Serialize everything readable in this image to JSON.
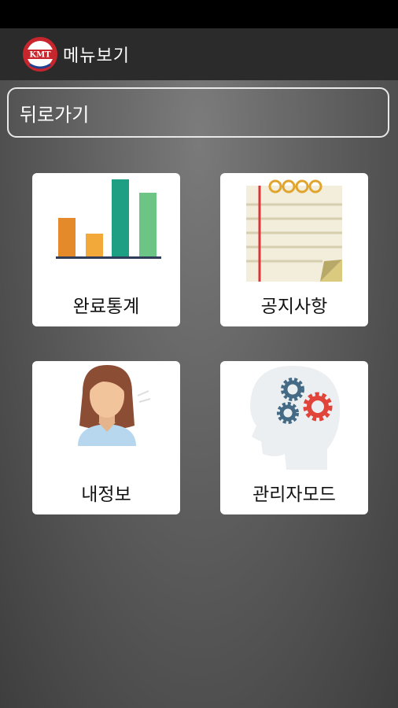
{
  "app": {
    "title": "메뉴보기",
    "logo_text": "KMT",
    "logo_colors": {
      "ring": "#c8262d",
      "band": "#1f3f8f",
      "fill": "#ffffff"
    }
  },
  "back_button": {
    "label": "뒤로가기"
  },
  "menu": {
    "tiles": [
      {
        "label": "완료통계",
        "icon": "bar-chart-icon"
      },
      {
        "label": "공지사항",
        "icon": "notepad-icon"
      },
      {
        "label": "내정보",
        "icon": "user-avatar-icon"
      },
      {
        "label": "관리자모드",
        "icon": "head-gears-icon"
      }
    ]
  }
}
